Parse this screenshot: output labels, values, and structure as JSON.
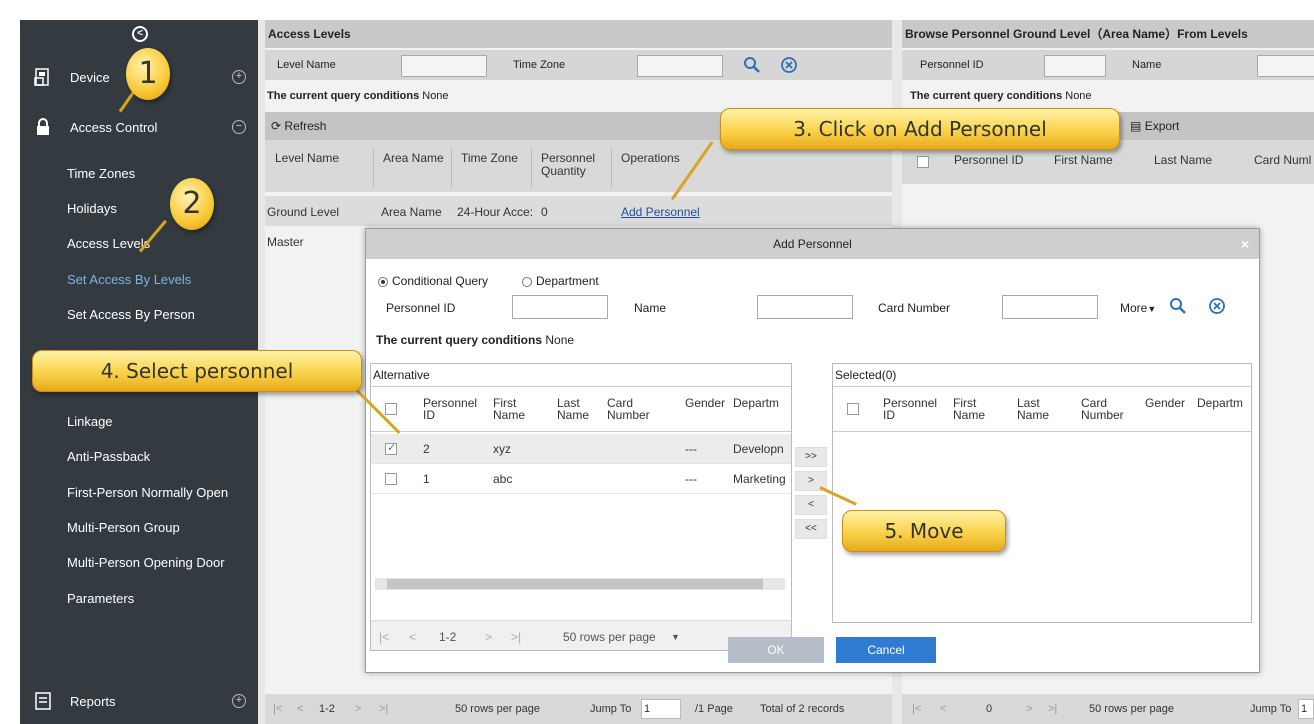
{
  "sidebar": {
    "collapse_icon": "collapse-icon",
    "device_label": "Device",
    "access_control_label": "Access Control",
    "reports_label": "Reports",
    "items": [
      "Time Zones",
      "Holidays",
      "Access Levels",
      "Set Access By Levels",
      "Set Access By Person",
      "Linkage",
      "Anti-Passback",
      "First-Person Normally Open",
      "Multi-Person Group",
      "Multi-Person Opening Door",
      "Parameters"
    ],
    "active_item": "Set Access By Levels"
  },
  "levels_panel": {
    "title": "Access Levels",
    "level_name_label": "Level Name",
    "time_zone_label": "Time Zone",
    "condition_label": "The current query conditions",
    "condition_value": "None",
    "refresh_label": "Refresh",
    "columns": [
      "Level Name",
      "Area Name",
      "Time Zone",
      "Personnel Quantity",
      "Operations"
    ],
    "rows": [
      {
        "level": "Ground Level",
        "area": "Area Name",
        "tz": "24-Hour Acce:",
        "qty": "0",
        "op": "Add Personnel"
      },
      {
        "level": "Master",
        "area": "",
        "tz": "",
        "qty": "",
        "op": ""
      }
    ],
    "footer": {
      "page": "1-2",
      "rows_per_page": "50 rows per page",
      "jump_to": "Jump To",
      "jump_value": "1",
      "pages": "/1 Page",
      "total": "Total of 2 records"
    }
  },
  "personnel_panel": {
    "title": "Browse Personnel Ground Level（Area Name）From Levels",
    "personnel_id_label": "Personnel ID",
    "name_label": "Name",
    "condition_label": "The current query conditions",
    "condition_value": "None",
    "export_label": "Export",
    "columns": [
      "Personnel ID",
      "First Name",
      "Last Name",
      "Card Numl"
    ],
    "footer": {
      "page": "0",
      "rows_per_page": "50 rows per page",
      "jump_to": "Jump To",
      "jump_value": "1"
    }
  },
  "modal": {
    "title": "Add Personnel",
    "close": "×",
    "radio_conditional": "Conditional Query",
    "radio_department": "Department",
    "personnel_id_label": "Personnel ID",
    "name_label": "Name",
    "card_number_label": "Card Number",
    "more_label": "More",
    "condition_label": "The current query conditions",
    "condition_value": "None",
    "alternative_label": "Alternative",
    "selected_label": "Selected(0)",
    "columns": [
      "Personnel ID",
      "First Name",
      "Last Name",
      "Card Number",
      "Gender",
      "Departm"
    ],
    "alt_rows": [
      {
        "id": "2",
        "first": "xyz",
        "last": "",
        "card": "",
        "gender": "---",
        "dept": "Developn",
        "checked": true
      },
      {
        "id": "1",
        "first": "abc",
        "last": "",
        "card": "",
        "gender": "---",
        "dept": "Marketing",
        "checked": false
      }
    ],
    "move_buttons": [
      ">>",
      ">",
      "<",
      "<<"
    ],
    "pager": {
      "page": "1-2",
      "rows_per_page": "50 rows per page"
    },
    "ok_label": "OK",
    "cancel_label": "Cancel"
  },
  "callouts": {
    "step1": "1",
    "step2": "2",
    "step3": "3. Click on Add Personnel",
    "step4": "4. Select personnel",
    "step5": "5. Move"
  },
  "colors": {
    "sidebar_bg": "#333b41",
    "active_link": "#7fb3e6",
    "cancel_btn": "#2e7bd1",
    "ok_btn": "#b5bec8",
    "callout": "#f9d24a"
  }
}
